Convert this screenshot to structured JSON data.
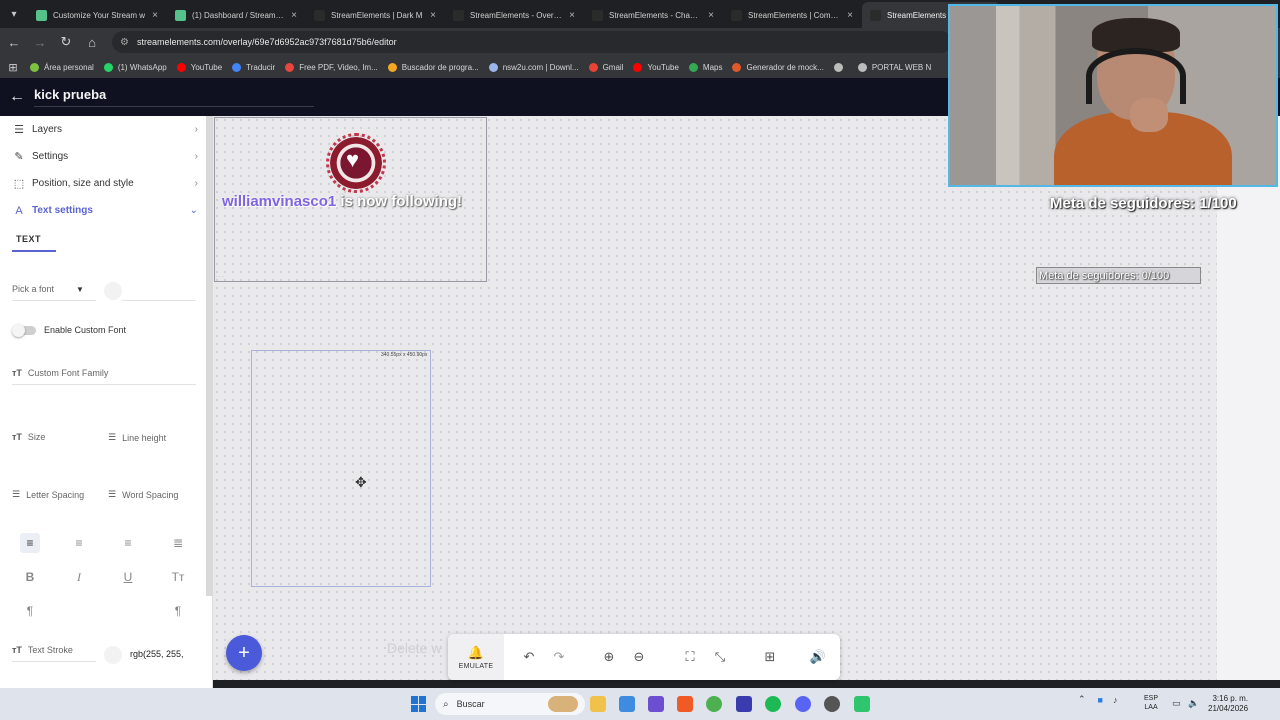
{
  "browser": {
    "tabs": [
      {
        "title": "Customize Your Stream w",
        "color": "#53c28b",
        "active": false
      },
      {
        "title": "(1) Dashboard / Streamlab",
        "color": "#53c28b",
        "active": false
      },
      {
        "title": "StreamElements | Dark M",
        "color": "#2b2b2b",
        "active": false
      },
      {
        "title": "StreamElements - Overlay",
        "color": "#2b2b2b",
        "active": false
      },
      {
        "title": "StreamElements - Channe",
        "color": "#2b2b2b",
        "active": false
      },
      {
        "title": "StreamElements | Comple",
        "color": "#2b2b2b",
        "active": false
      },
      {
        "title": "StreamElements -",
        "color": "#2b2b2b",
        "active": true
      }
    ],
    "url": "streamelements.com/overlay/69e7d6952ac973f7681d75b6/editor",
    "bookmarks": [
      {
        "label": "Área personal",
        "color": "#7cc242"
      },
      {
        "label": "(1) WhatsApp",
        "color": "#25d366"
      },
      {
        "label": "YouTube",
        "color": "#ff0000"
      },
      {
        "label": "Traducir",
        "color": "#4285f4"
      },
      {
        "label": "Free PDF, Video, Im...",
        "color": "#e8453c"
      },
      {
        "label": "Buscador de progra...",
        "color": "#f5a623"
      },
      {
        "label": "nsw2u.com | Downl...",
        "color": "#9ab6e8"
      },
      {
        "label": "Gmail",
        "color": "#ea4335"
      },
      {
        "label": "YouTube",
        "color": "#ff0000"
      },
      {
        "label": "Maps",
        "color": "#34a853"
      },
      {
        "label": "Generador de mock...",
        "color": "#e0592a"
      },
      {
        "label": "",
        "color": "#bbbbbb"
      },
      {
        "label": "PORTAL WEB N",
        "color": "#bbbbbb"
      }
    ]
  },
  "editor": {
    "overlay_name": "kick prueba",
    "panel": {
      "rows": [
        {
          "label": "Layers",
          "icon": "layers-icon",
          "glyph": "☰"
        },
        {
          "label": "Settings",
          "icon": "wrench-icon",
          "glyph": "🔧"
        },
        {
          "label": "Position, size and style",
          "icon": "position-icon",
          "glyph": "⬚"
        },
        {
          "label": "Text settings",
          "icon": "text-icon",
          "glyph": "A"
        }
      ],
      "tab_text": "TEXT",
      "font_placeholder": "Pick a font",
      "enable_custom_font": "Enable Custom Font",
      "custom_font_family": "Custom Font Family",
      "size": "Size",
      "line_height": "Line height",
      "letter_spacing": "Letter Spacing",
      "word_spacing": "Word Spacing",
      "text_stroke": "Text Stroke",
      "stroke_color": "rgb(255, 255,"
    },
    "canvas": {
      "follower_name": "williamvinasco1",
      "follow_text": " is now following!",
      "widget_size_label": "340.55px x 450.90px",
      "goal_label": "Meta de seguidores: 0/100",
      "delete_hint": "Delete w"
    },
    "toolbar": {
      "emulate": "EMULATE"
    }
  },
  "stream_overlay": {
    "goal": "Meta de seguidores: 1/100"
  },
  "taskbar": {
    "search": "Buscar",
    "lang": "ESP",
    "lang_region": "LAA",
    "time": "3:16 p. m.",
    "date": "21/04/2026"
  }
}
